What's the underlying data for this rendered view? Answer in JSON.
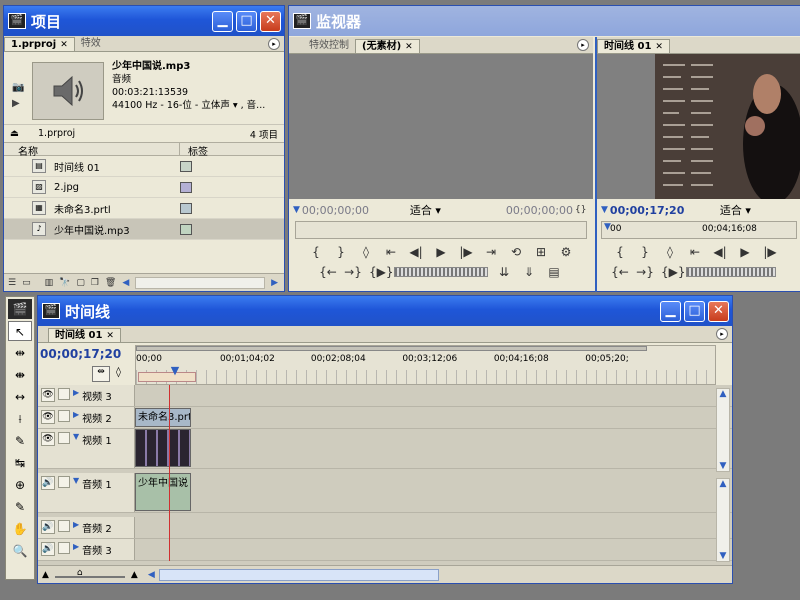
{
  "project": {
    "title": "项目",
    "tabs": [
      "1.prproj",
      "特效"
    ],
    "preview": {
      "name": "少年中国说.mp3",
      "type": "音频",
      "duration": "00:03:21:13539",
      "format": "44100 Hz - 16-位 - 立体声 ▾ , 音..."
    },
    "bin_name": "1.prproj",
    "item_count": "4 项目",
    "col_name": "名称",
    "col_label": "标签",
    "items": [
      {
        "name": "时间线 01",
        "icon": "sequence-icon",
        "color": "#c8d4c8"
      },
      {
        "name": "2.jpg",
        "icon": "image-icon",
        "color": "#b4b0d4"
      },
      {
        "name": "未命名3.prtl",
        "icon": "title-icon",
        "color": "#b8c8d0"
      },
      {
        "name": "少年中国说.mp3",
        "icon": "audio-file-icon",
        "color": "#c0d4c0"
      }
    ]
  },
  "monitor": {
    "title": "监视器",
    "source_tabs": [
      "特效控制",
      "(无素材)"
    ],
    "source_timecode": "00;00;00;00",
    "source_fit": "适合",
    "source_right_timecode": "00;00;00;00",
    "program_tab": "时间线 01",
    "program_timecode": "00;00;17;20",
    "program_fit": "适合",
    "program_ruler": [
      "00",
      "00;04;16;08"
    ]
  },
  "timeline": {
    "title": "时间线",
    "tab": "时间线 01",
    "timecode": "00;00;17;20",
    "ruler": [
      "00;00",
      "00;01;04;02",
      "00;02;08;04",
      "00;03;12;06",
      "00;04;16;08",
      "00;05;20;"
    ],
    "tracks": [
      {
        "name": "视频 3",
        "kind": "video"
      },
      {
        "name": "视频 2",
        "kind": "video"
      },
      {
        "name": "视频 1",
        "kind": "video"
      },
      {
        "name": "音频 1",
        "kind": "audio"
      },
      {
        "name": "音频 2",
        "kind": "audio"
      },
      {
        "name": "音频 3",
        "kind": "audio"
      }
    ],
    "clips": {
      "video2": "未命名3.prtl",
      "audio1": "少年中国说"
    },
    "playhead_fraction": 0.06
  },
  "tools": [
    "track-select-icon",
    "select-icon",
    "ripple-edit-icon",
    "rolling-edit-icon",
    "rate-stretch-icon",
    "razor-icon",
    "slip-icon",
    "slide-icon",
    "pen-icon",
    "hand-icon",
    "zoom-icon"
  ]
}
